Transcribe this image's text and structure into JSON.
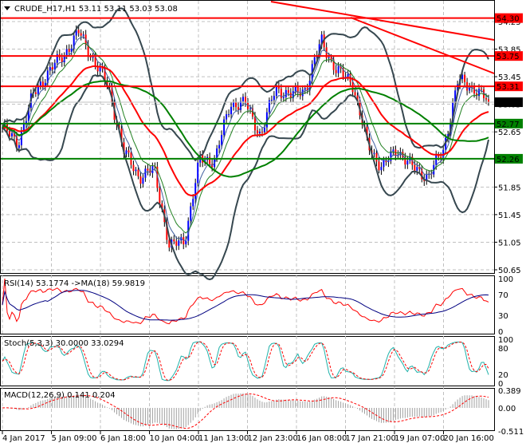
{
  "header": {
    "symbol_line": "CRUDE_H17,H1  53.11 53.11 53.03 53.08"
  },
  "colors": {
    "bull": "#0000ff",
    "bear": "#ff0000",
    "bands": "#36474f",
    "ma_red": "#ff0000",
    "ma_green": "#008000",
    "resistance": "#ff0000",
    "support": "#008000",
    "current": "#000000"
  },
  "chart_data": [
    {
      "type": "candlestick",
      "title": "CRUDE_H17,H1",
      "ohlc_last": {
        "open": 53.11,
        "high": 53.11,
        "low": 53.03,
        "close": 53.08
      },
      "ylim": [
        50.6,
        54.45
      ],
      "y_ticks": [
        "54.25",
        "53.85",
        "53.45",
        "53.05",
        "52.65",
        "51.85",
        "51.45",
        "51.05",
        "50.65"
      ],
      "x_ticks": [
        "4 Jan 2017",
        "5 Jan 09:00",
        "6 Jan 18:00",
        "10 Jan 04:00",
        "11 Jan 13:00",
        "12 Jan 23:00",
        "16 Jan 08:00",
        "17 Jan 21:00",
        "19 Jan 07:00",
        "20 Jan 16:00"
      ],
      "close_path": [
        52.71,
        52.48,
        53.17,
        53.52,
        53.75,
        54.1,
        53.7,
        53.29,
        52.36,
        52.0,
        52.1,
        50.97,
        51.09,
        52.25,
        52.25,
        53.06,
        53.06,
        52.6,
        53.29,
        53.17,
        53.29,
        53.98,
        53.52,
        53.4,
        52.48,
        52.13,
        52.4,
        52.13,
        52.0,
        52.36,
        53.4,
        53.29,
        53.08
      ],
      "levels": [
        {
          "label": "54.30",
          "value": 54.3,
          "kind": "resistance"
        },
        {
          "label": "53.75",
          "value": 53.75,
          "kind": "resistance"
        },
        {
          "label": "53.31",
          "value": 53.31,
          "kind": "resistance"
        },
        {
          "label": "53.08",
          "value": 53.08,
          "kind": "current"
        },
        {
          "label": "52.77",
          "value": 52.77,
          "kind": "support"
        },
        {
          "label": "52.26",
          "value": 52.26,
          "kind": "support"
        }
      ]
    },
    {
      "type": "line",
      "title": "RSI(14) 53.1774  ->MA(18) 59.9819",
      "ylim": [
        0,
        100
      ],
      "y_ticks": [
        "100",
        "70",
        "30",
        "0"
      ]
    },
    {
      "type": "line",
      "title": "Stoch(5,3,3) 30.0000 33.0294",
      "ylim": [
        0,
        100
      ],
      "y_ticks": [
        "100",
        "80",
        "20",
        "0"
      ]
    },
    {
      "type": "bar",
      "title": "MACD(12,26,9) 0.141 0.204",
      "ylim": [
        -0.511,
        0.389
      ],
      "y_ticks": [
        "0.389",
        "0.00",
        "-0.511"
      ]
    }
  ]
}
